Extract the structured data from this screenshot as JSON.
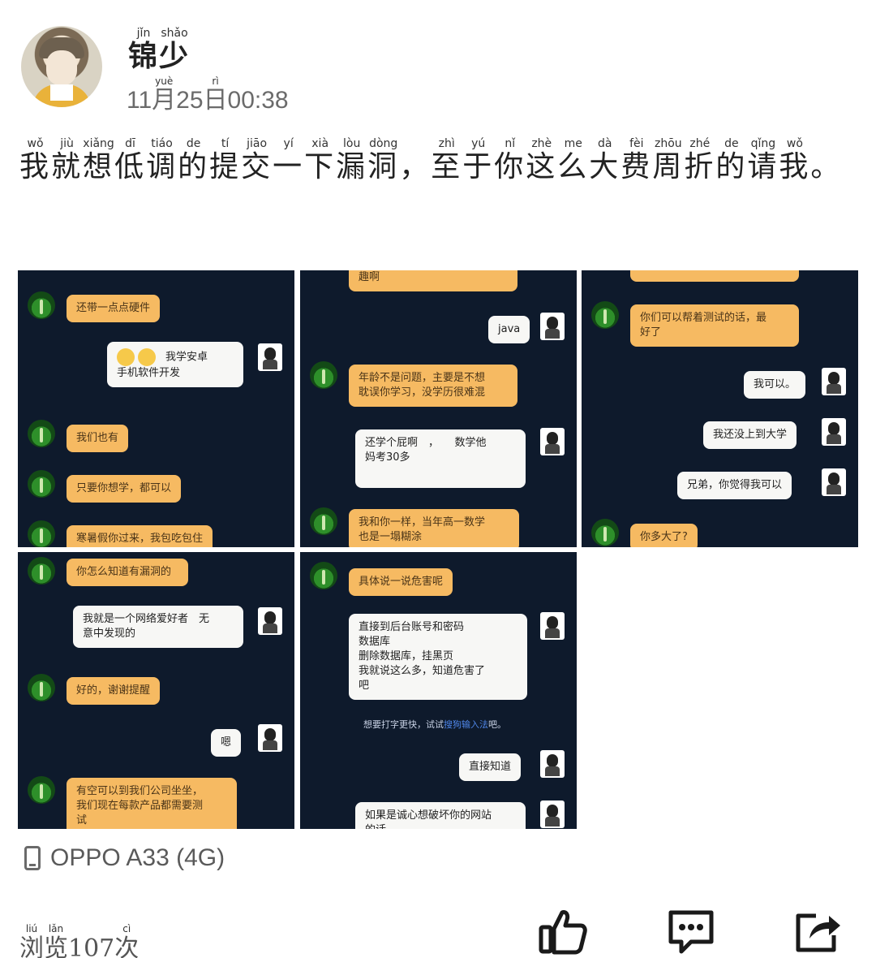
{
  "post": {
    "author": "锦少",
    "author_pinyin": [
      "jǐn",
      "shǎo"
    ],
    "timestamp_parts": [
      {
        "text": "11"
      },
      {
        "text": "月",
        "rt": "yuè"
      },
      {
        "text": "25"
      },
      {
        "text": "日",
        "rt": "rì"
      },
      {
        "text": "00:38"
      }
    ],
    "text_chars": [
      {
        "c": "我",
        "p": "wǒ"
      },
      {
        "c": "就",
        "p": "jiù"
      },
      {
        "c": "想",
        "p": "xiǎng"
      },
      {
        "c": "低",
        "p": "dī"
      },
      {
        "c": "调",
        "p": "tiáo"
      },
      {
        "c": "的",
        "p": "de"
      },
      {
        "c": "提",
        "p": "tí"
      },
      {
        "c": "交",
        "p": "jiāo"
      },
      {
        "c": "一",
        "p": "yí"
      },
      {
        "c": "下",
        "p": "xià"
      },
      {
        "c": "漏",
        "p": "lòu"
      },
      {
        "c": "洞",
        "p": "dòng"
      },
      {
        "c": "，",
        "p": ""
      },
      {
        "c": "至",
        "p": "zhì"
      },
      {
        "c": "于",
        "p": "yú"
      },
      {
        "c": "你",
        "p": "nǐ"
      },
      {
        "c": "这",
        "p": "zhè"
      },
      {
        "c": "么",
        "p": "me"
      },
      {
        "c": "大",
        "p": "dà"
      },
      {
        "c": "费",
        "p": "fèi"
      },
      {
        "c": "周",
        "p": "zhōu"
      },
      {
        "c": "折",
        "p": "zhé"
      },
      {
        "c": "的",
        "p": "de"
      },
      {
        "c": "请",
        "p": "qǐng"
      },
      {
        "c": "我",
        "p": "wǒ"
      },
      {
        "c": "。",
        "p": ""
      }
    ]
  },
  "images": {
    "t1": {
      "m1": "还带一点点硬件",
      "m2": "我学安卓\n手机软件开发",
      "m3": "我们也有",
      "m4": "只要你想学，都可以",
      "m5": "寒暑假你过来，我包吃包住"
    },
    "t2": {
      "m0": "趣啊",
      "m1": "java",
      "m2": "年龄不是问题，主要是不想\n耽误你学习，没学历很难混",
      "m3": "还学个屁啊　，　　数学他\n妈考30多",
      "m4": "我和你一样，当年高一数学\n也是一塌糊涂"
    },
    "t3": {
      "m1": "你们可以帮着测试的话，最\n好了",
      "m2": "我可以。",
      "m3": "我还没上到大学",
      "m4": "兄弟，你觉得我可以",
      "m5": "你多大了?"
    },
    "t4": {
      "m1": "你怎么知道有漏洞的",
      "m2": "我就是一个网络爱好者　无\n意中发现的",
      "m3": "好的，谢谢提醒",
      "m4": "嗯",
      "m5": "有空可以到我们公司坐坐，\n我们现在每款产品都需要测\n试"
    },
    "t5": {
      "m1": "具体说一说危害呢",
      "m2": "直接到后台账号和密码\n数据库\n删除数据库，挂黑页\n我就说这么多，知道危害了\n吧",
      "hint_pre": "想要打字更快，试试",
      "hint_link": "搜狗输入法",
      "hint_post": "吧。",
      "m3": "直接知道",
      "m4": "如果是诚心想破坏你的网站\n的话"
    }
  },
  "device": {
    "label": "OPPO A33 (4G)",
    "icon": "phone-icon"
  },
  "stats": {
    "views_parts": [
      {
        "text": "浏",
        "rt": "liú"
      },
      {
        "text": "览",
        "rt": "lǎn"
      },
      {
        "text": "107"
      },
      {
        "text": "次",
        "rt": "cì"
      }
    ]
  },
  "actions": {
    "like_icon": "thumbs-up-icon",
    "comment_icon": "comment-icon",
    "share_icon": "share-icon"
  },
  "colors": {
    "chat_bg": "#0e1a2c",
    "bubble_in": "#f6ba62",
    "bubble_out": "#f7f7f5"
  }
}
